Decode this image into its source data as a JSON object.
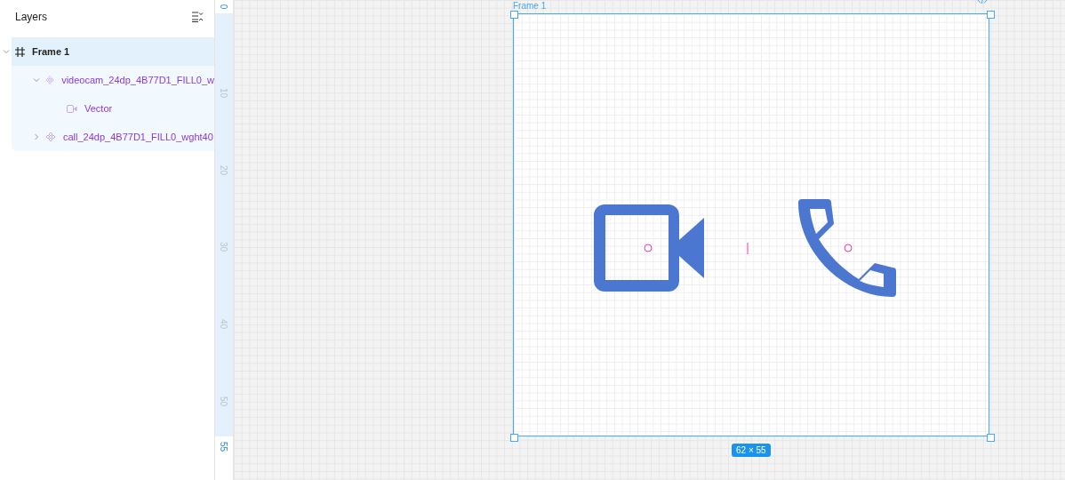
{
  "layers_panel": {
    "title": "Layers",
    "tree": [
      {
        "label": "Frame 1",
        "kind": "frame",
        "selected": true,
        "expanded": true,
        "children": [
          {
            "label": "videocam_24dp_4B77D1_FILL0_w",
            "kind": "component",
            "selected": false,
            "expanded": true,
            "children": [
              {
                "label": "Vector",
                "kind": "vector",
                "selected": false
              }
            ]
          },
          {
            "label": "call_24dp_4B77D1_FILL0_wght40",
            "kind": "component",
            "selected": false,
            "expanded": false
          }
        ]
      }
    ]
  },
  "ruler": {
    "start": "0",
    "ticks": [
      "10",
      "20",
      "30",
      "40",
      "50"
    ],
    "end": "55"
  },
  "canvas": {
    "frame_label": "Frame 1",
    "size_badge": "62 × 55"
  }
}
